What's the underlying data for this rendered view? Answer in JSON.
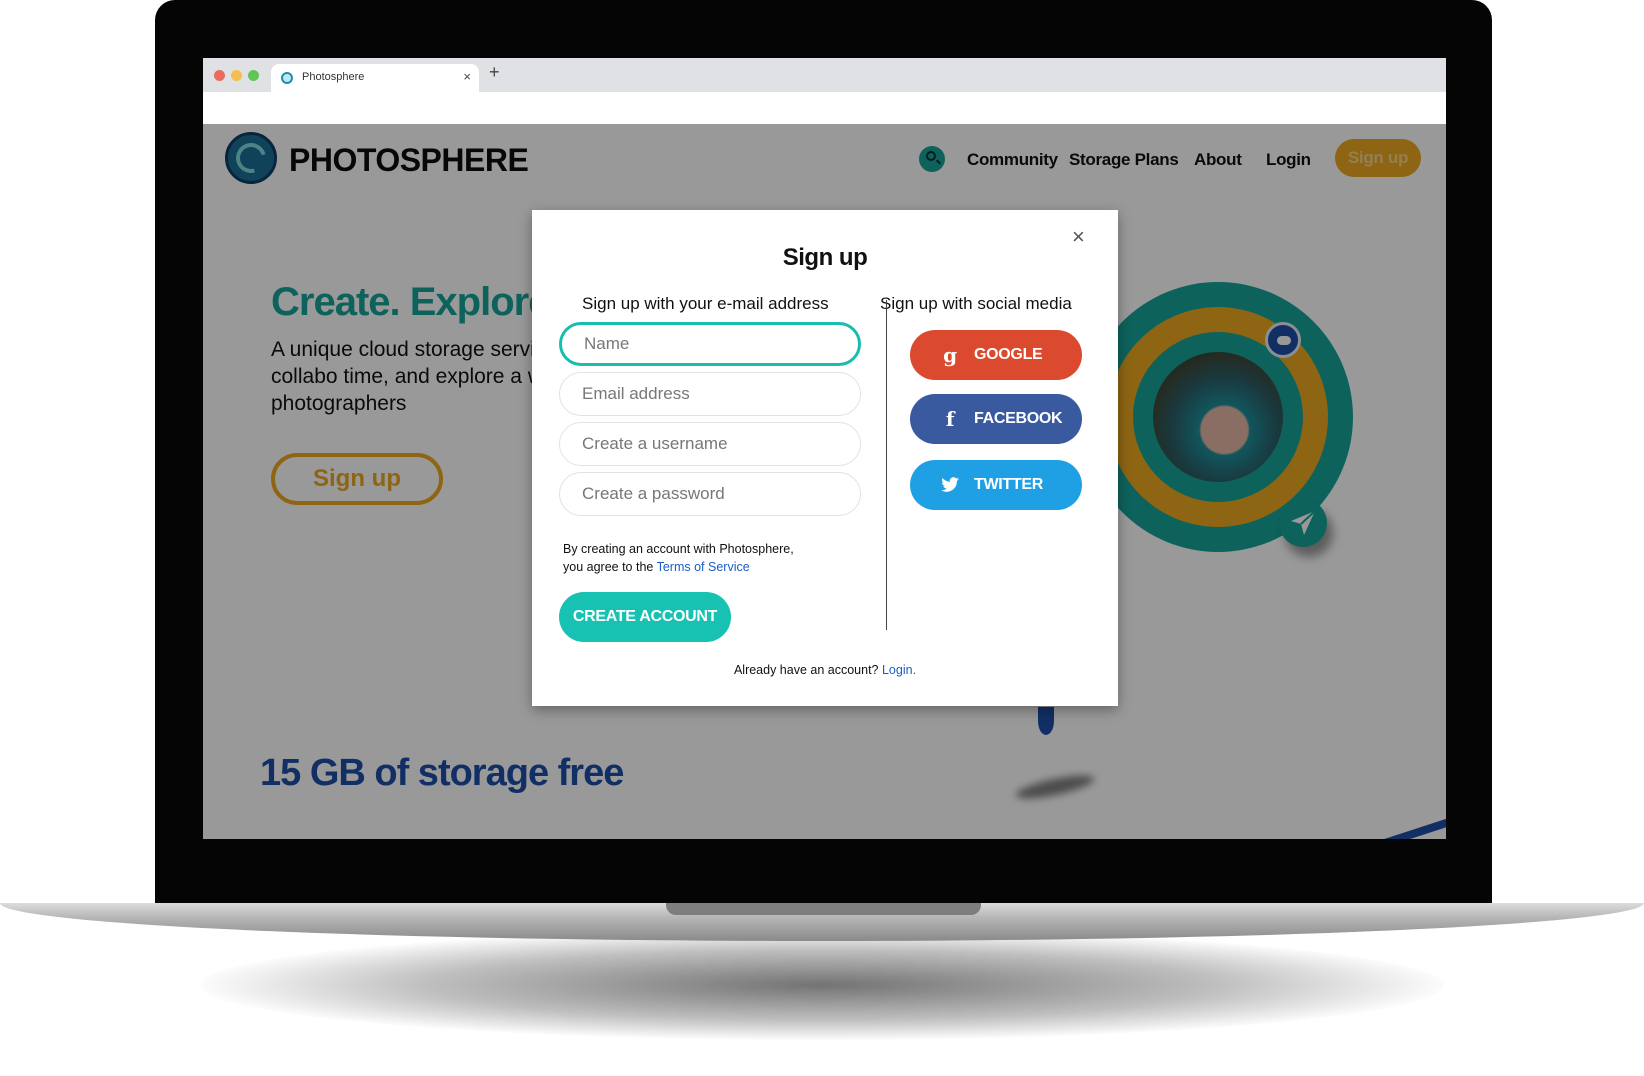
{
  "browser": {
    "tab_title": "Photosphere",
    "tab_close": "×",
    "new_tab": "+"
  },
  "site": {
    "brand": "PHOTOSPHERE",
    "nav": {
      "community": "Community",
      "storage_plans": "Storage Plans",
      "about": "About",
      "login": "Login",
      "signup": "Sign up"
    },
    "hero": {
      "heading": "Create. Explore",
      "text": "A unique cloud storage servi to create documents, collabo time, and explore a wide vari community of photographers",
      "button": "Sign up"
    },
    "storage_heading": "15 GB of storage free"
  },
  "modal": {
    "close": "×",
    "title": "Sign up",
    "email_heading": "Sign up with your e-mail address",
    "social_heading": "Sign up with social media",
    "fields": {
      "name_placeholder": "Name",
      "email_placeholder": "Email address",
      "username_placeholder": "Create a username",
      "password_placeholder": "Create a password"
    },
    "terms_prefix": "By creating an account with Photosphere,",
    "terms_middle": "you agree to the",
    "terms_link": "Terms of Service",
    "create_button": "CREATE ACCOUNT",
    "social": {
      "google": "GOOGLE",
      "google_icon": "g",
      "facebook": "FACEBOOK",
      "facebook_icon": "f",
      "twitter": "TWITTER"
    },
    "already_text": "Already have an account?",
    "login_link": "Login."
  },
  "colors": {
    "teal": "#17a59a",
    "gold": "#eba820",
    "blue": "#1e4fa8",
    "google": "#db4a2e",
    "facebook": "#3a5aa0",
    "twitter": "#1fa0e4"
  }
}
